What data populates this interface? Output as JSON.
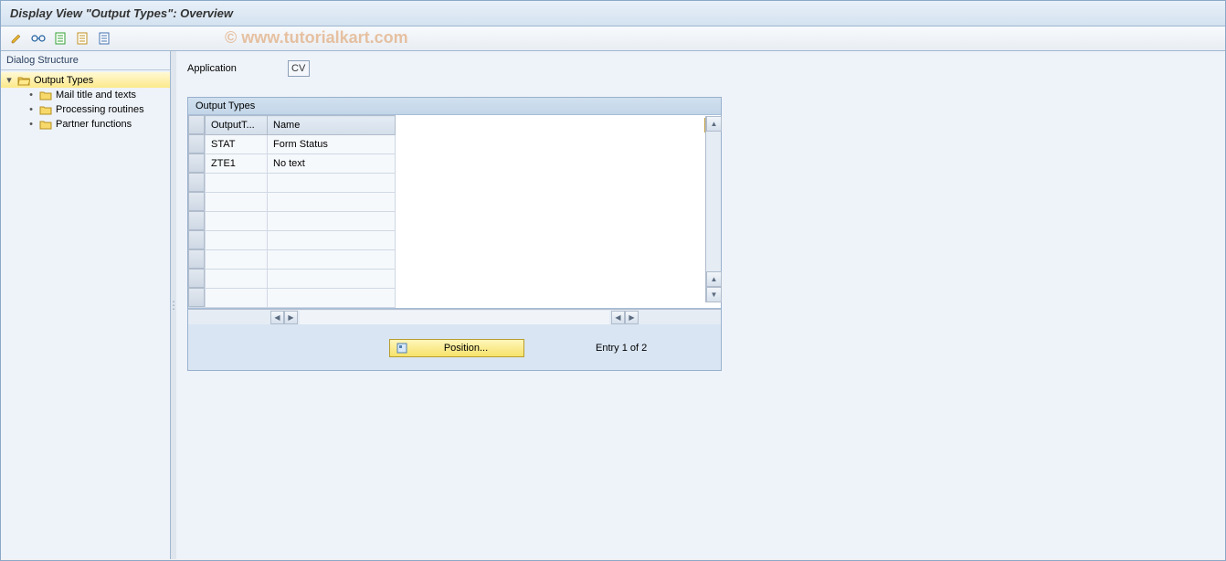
{
  "window": {
    "title": "Display View \"Output Types\": Overview"
  },
  "watermark": "© www.tutorialkart.com",
  "sidebar": {
    "header": "Dialog Structure",
    "tree": {
      "root": "Output Types",
      "children": [
        "Mail title and texts",
        "Processing routines",
        "Partner functions"
      ]
    }
  },
  "main": {
    "application_label": "Application",
    "application_value": "CV",
    "panel_title": "Output Types",
    "table": {
      "headers": {
        "code": "OutputT...",
        "name": "Name"
      },
      "rows": [
        {
          "code": "STAT",
          "name": "Form Status"
        },
        {
          "code": "ZTE1",
          "name": "No text"
        }
      ]
    },
    "position_button": "Position...",
    "entry_status": "Entry 1 of 2"
  }
}
